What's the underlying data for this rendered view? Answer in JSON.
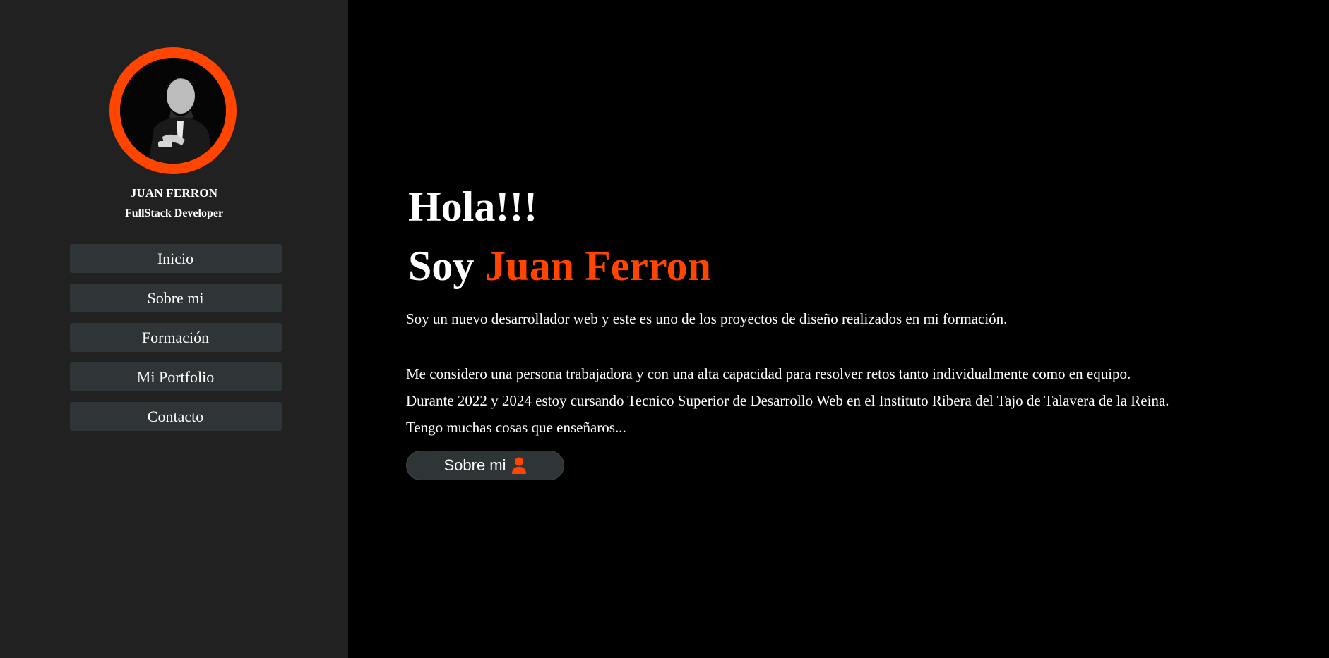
{
  "colors": {
    "accent": "#ff4500",
    "sidebar_bg": "#212121",
    "main_bg": "#000000",
    "nav_bg": "#2f3436",
    "text": "#ffffff"
  },
  "sidebar": {
    "name": "JUAN FERRON",
    "role": "FullStack Developer",
    "avatar_icon": "profile-photo",
    "nav": [
      {
        "label": "Inicio"
      },
      {
        "label": "Sobre mi"
      },
      {
        "label": "Formación"
      },
      {
        "label": "Mi Portfolio"
      },
      {
        "label": "Contacto"
      }
    ]
  },
  "main": {
    "greeting": "Hola!!!",
    "intro_prefix": "Soy",
    "intro_name": "Juan Ferron",
    "intro_text": "Soy un nuevo desarrollador web y este es uno de los proyectos de diseño realizados en mi formación.",
    "paragraph": [
      "Me considero una persona trabajadora y con una alta capacidad para resolver retos tanto individualmente como en equipo.",
      "Durante 2022 y 2024 estoy cursando Tecnico Superior de Desarrollo Web en el Instituto Ribera del Tajo de Talavera de la Reina.",
      "Tengo muchas cosas que enseñaros..."
    ],
    "about_button": {
      "label": "Sobre mi",
      "icon": "user-icon"
    }
  }
}
